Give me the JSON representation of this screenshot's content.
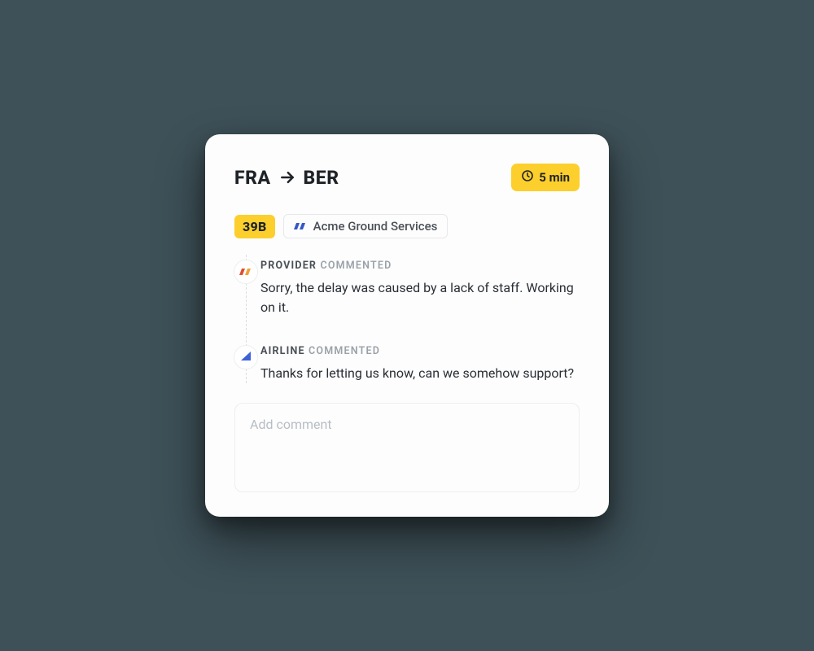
{
  "route": {
    "origin": "FRA",
    "destination": "BER"
  },
  "time_badge": "5 min",
  "gate": "39B",
  "provider_chip": "Acme Ground Services",
  "timeline": [
    {
      "role": "PROVIDER",
      "action": "COMMENTED",
      "body": "Sorry, the delay was caused by a lack of staff. Working on it."
    },
    {
      "role": "AIRLINE",
      "action": "COMMENTED",
      "body": "Thanks for letting us know, can we somehow support?"
    }
  ],
  "comment_placeholder": "Add comment"
}
